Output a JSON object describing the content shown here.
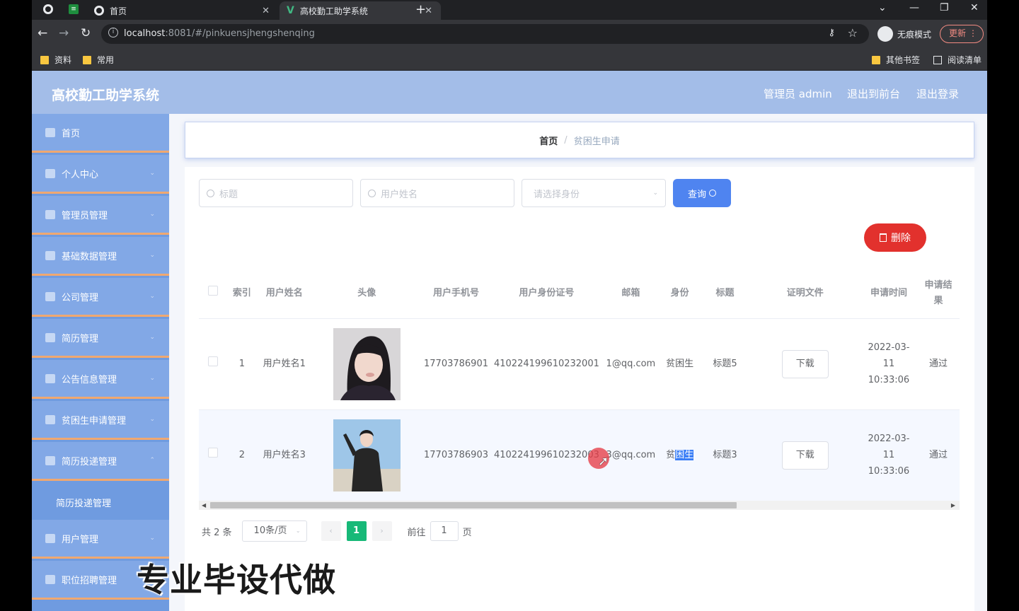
{
  "browser": {
    "tabs": [
      {
        "label": "首页"
      },
      {
        "label": "高校勤工助学系统"
      }
    ],
    "url_host": "localhost",
    "url_path": ":8081/#/pinkuensjhengshenqing",
    "incognito_label": "无痕模式",
    "update_label": "更新",
    "bookmarks": [
      "资料",
      "常用"
    ],
    "other_bookmarks": "其他书签",
    "reading_list": "阅读清单"
  },
  "app": {
    "title": "高校勤工助学系统",
    "user_label": "管理员 admin",
    "exit_front": "退出到前台",
    "logout": "退出登录"
  },
  "sidebar": {
    "items": [
      {
        "label": "首页",
        "icon": "home-icon"
      },
      {
        "label": "个人中心",
        "icon": "user-icon"
      },
      {
        "label": "管理员管理",
        "icon": "admin-icon"
      },
      {
        "label": "基础数据管理",
        "icon": "grid-icon"
      },
      {
        "label": "公司管理",
        "icon": "company-icon"
      },
      {
        "label": "简历管理",
        "icon": "resume-icon"
      },
      {
        "label": "公告信息管理",
        "icon": "notice-icon"
      },
      {
        "label": "贫困生申请管理",
        "icon": "apply-icon"
      },
      {
        "label": "简历投递管理",
        "icon": "deliver-icon"
      },
      {
        "sub_label": "简历投递管理"
      },
      {
        "label": "用户管理",
        "icon": "users-icon"
      },
      {
        "label": "职位招聘管理",
        "icon": "chart-icon"
      }
    ]
  },
  "breadcrumb": {
    "home": "首页",
    "separator": "/",
    "current": "贫困生申请"
  },
  "filters": {
    "title_placeholder": "标题",
    "username_placeholder": "用户姓名",
    "identity_placeholder": "请选择身份",
    "query_label": "查询"
  },
  "delete_label": "删除",
  "table": {
    "headers": [
      "索引",
      "用户姓名",
      "头像",
      "用户手机号",
      "用户身份证号",
      "邮箱",
      "身份",
      "标题",
      "证明文件",
      "申请时间",
      "申请结果"
    ],
    "rows": [
      {
        "index": "1",
        "name": "用户姓名1",
        "phone": "17703786901",
        "idcard": "410224199610232001",
        "email": "1@qq.com",
        "identity": "贫困生",
        "title": "标题5",
        "file": "下载",
        "time": "2022-03-11 10:33:06",
        "result": "通过"
      },
      {
        "index": "2",
        "name": "用户姓名3",
        "phone": "17703786903",
        "idcard": "410224199610232003",
        "email": "3@qq.com",
        "identity_pre": "贫",
        "identity_hl": "困生",
        "title": "标题3",
        "file": "下载",
        "time": "2022-03-11 10:33:06",
        "result": "通过"
      }
    ]
  },
  "pagination": {
    "total": "共 2 条",
    "page_size": "10条/页",
    "current_page": "1",
    "goto_label": "前往",
    "goto_value": "1",
    "page_unit": "页"
  },
  "watermark": "专业毕设代做"
}
